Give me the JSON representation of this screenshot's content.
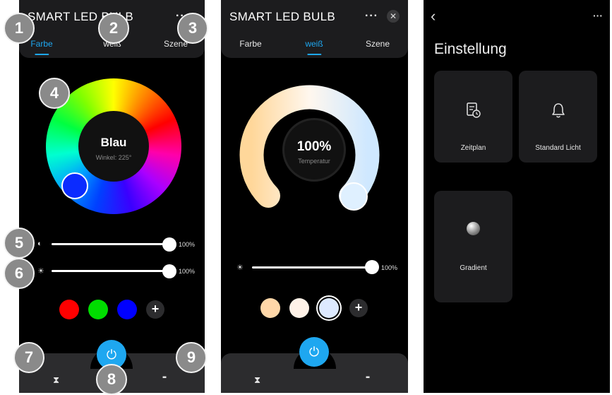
{
  "screen1": {
    "title": "SMART LED BULB",
    "more_icon": "···",
    "tabs": [
      "Farbe",
      "weiß",
      "Szene"
    ],
    "active_tab": "Farbe",
    "wheel": {
      "color_name": "Blau",
      "angle_text": "Winkel: 225°"
    },
    "contrast_slider": {
      "icon": "◐",
      "value_text": "100%"
    },
    "brightness_slider": {
      "icon": "☀",
      "value_text": "100%"
    },
    "swatches": [
      "#ff0000",
      "#00dd00",
      "#0000ff"
    ],
    "add_label": "+",
    "nav": {
      "timer_icon": "⧗",
      "power_icon": "⏻",
      "grid_icon": "▪▪"
    }
  },
  "screen2": {
    "title": "SMART LED BULB",
    "more_icon": "···",
    "close_icon": "✕",
    "tabs": [
      "Farbe",
      "weiß",
      "Szene"
    ],
    "active_tab": "weiß",
    "temperature": {
      "value_text": "100%",
      "label": "Temperatur"
    },
    "brightness_slider": {
      "icon": "☀",
      "value_text": "100%"
    },
    "swatches": [
      "#ffd7a8",
      "#fff2e8",
      "#dde9ff"
    ],
    "add_label": "+",
    "nav": {
      "timer_icon": "⧗",
      "power_icon": "⏻",
      "grid_icon": "▪▪"
    }
  },
  "screen3": {
    "back_icon": "‹",
    "more_icon": "···",
    "heading": "Einstellung",
    "cards": [
      {
        "label": "Zeitplan",
        "icon": "schedule-icon"
      },
      {
        "label": "Standard Licht",
        "icon": "bell-icon"
      },
      {
        "label": "Gradient",
        "icon": "gradient-icon"
      }
    ]
  },
  "badges": [
    "1",
    "2",
    "3",
    "4",
    "5",
    "6",
    "7",
    "8",
    "9"
  ],
  "colors": {
    "accent": "#1ea7f0",
    "background": "#000000",
    "panel": "#1c1c1e",
    "badge": "#8a8a8a"
  }
}
